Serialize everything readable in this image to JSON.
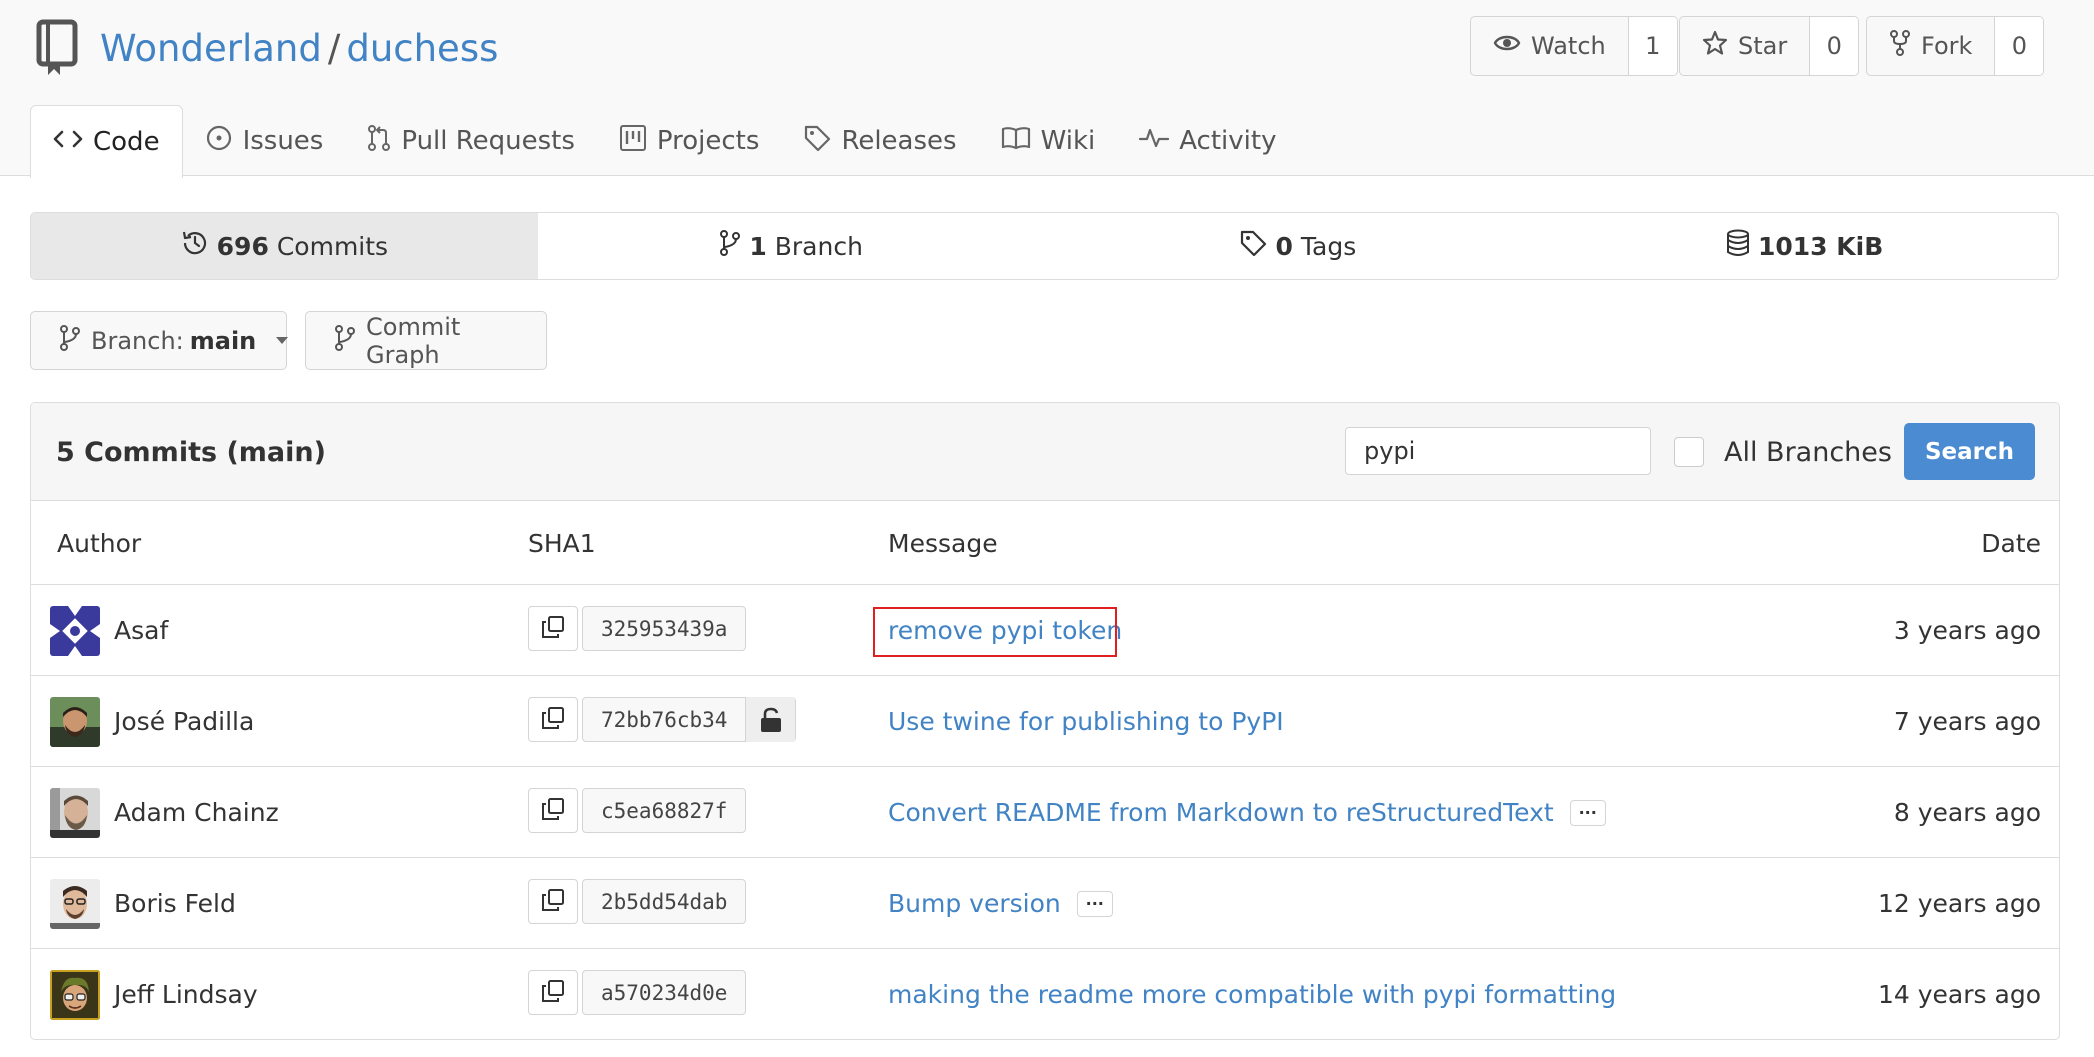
{
  "repo": {
    "owner": "Wonderland",
    "separator": "/",
    "name": "duchess"
  },
  "actions": {
    "watch": {
      "label": "Watch",
      "count": "1"
    },
    "star": {
      "label": "Star",
      "count": "0"
    },
    "fork": {
      "label": "Fork",
      "count": "0"
    }
  },
  "tabs": [
    {
      "label": "Code",
      "icon": "code-icon",
      "active": true
    },
    {
      "label": "Issues",
      "icon": "issue-icon"
    },
    {
      "label": "Pull Requests",
      "icon": "pull-request-icon"
    },
    {
      "label": "Projects",
      "icon": "project-icon"
    },
    {
      "label": "Releases",
      "icon": "tag-icon"
    },
    {
      "label": "Wiki",
      "icon": "book-icon"
    },
    {
      "label": "Activity",
      "icon": "pulse-icon"
    }
  ],
  "stats": {
    "commits": {
      "count": "696",
      "label": "Commits"
    },
    "branches": {
      "count": "1",
      "label": "Branch"
    },
    "tags": {
      "count": "0",
      "label": "Tags"
    },
    "size": {
      "value": "1013 KiB"
    }
  },
  "branch": {
    "prefix": "Branch:",
    "name": "main",
    "graph_label": "Commit Graph"
  },
  "commits_panel": {
    "title": "5 Commits (main)",
    "search_value": "pypi",
    "all_branches_label": "All Branches",
    "search_button": "Search",
    "headers": {
      "author": "Author",
      "sha": "SHA1",
      "message": "Message",
      "date": "Date"
    }
  },
  "commits": [
    {
      "author": "Asaf",
      "sha": "325953439a",
      "message": "remove pypi token",
      "date": "3 years ago",
      "has_more": false,
      "locked": false
    },
    {
      "author": "José Padilla",
      "sha": "72bb76cb34",
      "message": "Use twine for publishing to PyPI",
      "date": "7 years ago",
      "has_more": false,
      "locked": true
    },
    {
      "author": "Adam Chainz",
      "sha": "c5ea68827f",
      "message": "Convert README from Markdown to reStructuredText",
      "date": "8 years ago",
      "has_more": true,
      "locked": false
    },
    {
      "author": "Boris Feld",
      "sha": "2b5dd54dab",
      "message": "Bump version",
      "date": "12 years ago",
      "has_more": true,
      "locked": false
    },
    {
      "author": "Jeff Lindsay",
      "sha": "a570234d0e",
      "message": "making the readme more compatible with pypi formatting",
      "date": "14 years ago",
      "has_more": false,
      "locked": false
    }
  ],
  "ellipsis_label": "···",
  "colors": {
    "link": "#4183c4",
    "primary_button": "#4a8bd1",
    "highlight_border": "#e02020"
  }
}
